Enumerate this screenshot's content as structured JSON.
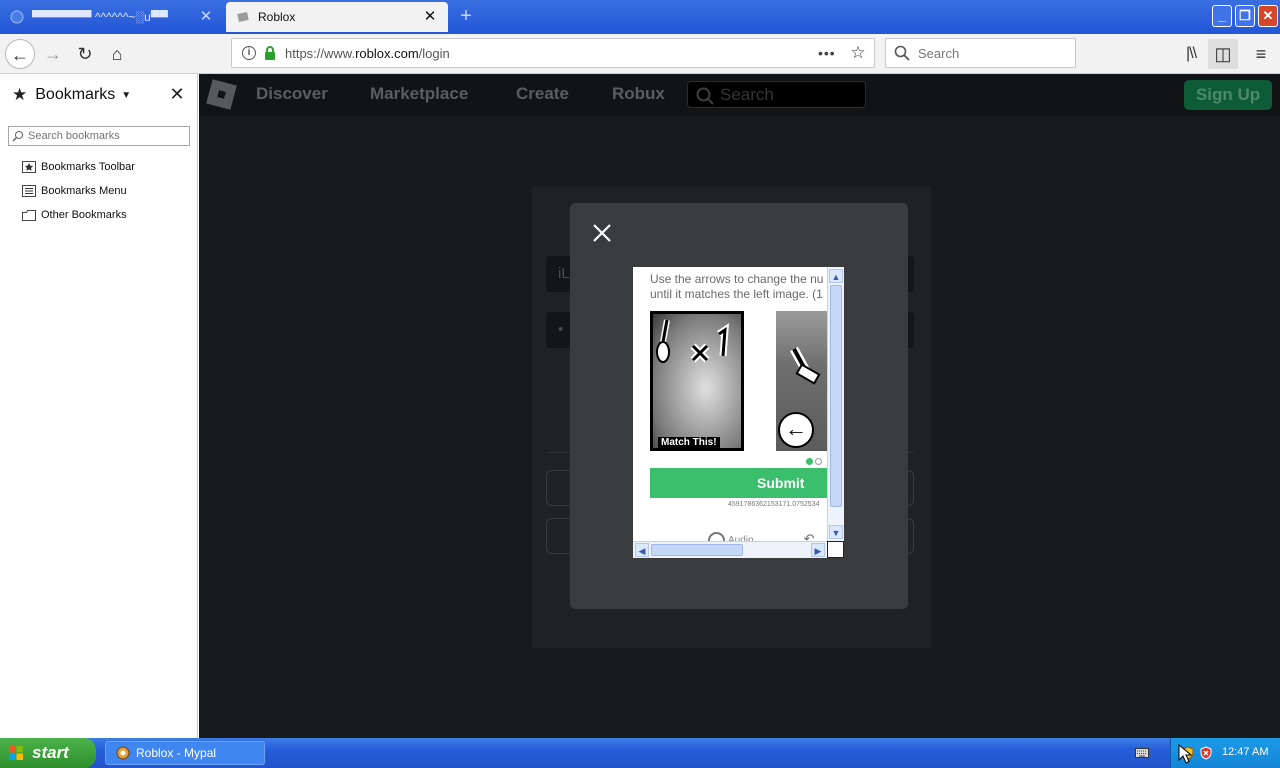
{
  "browser": {
    "tabs": [
      {
        "title": "▀▀▀▀▀▀▀ ^^^^^^~░u▀▀"
      },
      {
        "title": "Roblox"
      }
    ],
    "url": {
      "domain": "https://www.",
      "host": "roblox.com",
      "path": "/login"
    },
    "search_placeholder": "Search"
  },
  "sidebar": {
    "title": "Bookmarks",
    "search_placeholder": "Search bookmarks",
    "items": [
      {
        "label": "Bookmarks Toolbar"
      },
      {
        "label": "Bookmarks Menu"
      },
      {
        "label": "Other Bookmarks"
      }
    ]
  },
  "roblox": {
    "nav": [
      "Discover",
      "Marketplace",
      "Create",
      "Robux"
    ],
    "search_placeholder": "Search",
    "signup_label": "Sign Up",
    "field_username_text": "iL",
    "field_password_text": "•"
  },
  "captcha": {
    "instruction_line1": "Use the arrows to change the nu",
    "instruction_line2": "until it matches the left image. (1",
    "reference_label": "Match This!",
    "submit_label": "Submit",
    "session_id": "4591786362153171.0752534",
    "audio_label": "Audio"
  },
  "taskbar": {
    "start_label": "start",
    "task_label": "Roblox - Mypal",
    "clock": "12:47 AM"
  },
  "colors": {
    "accent_green": "#3bbf6d",
    "xp_blue": "#245ed8",
    "roblox_bg": "#191a1b"
  }
}
